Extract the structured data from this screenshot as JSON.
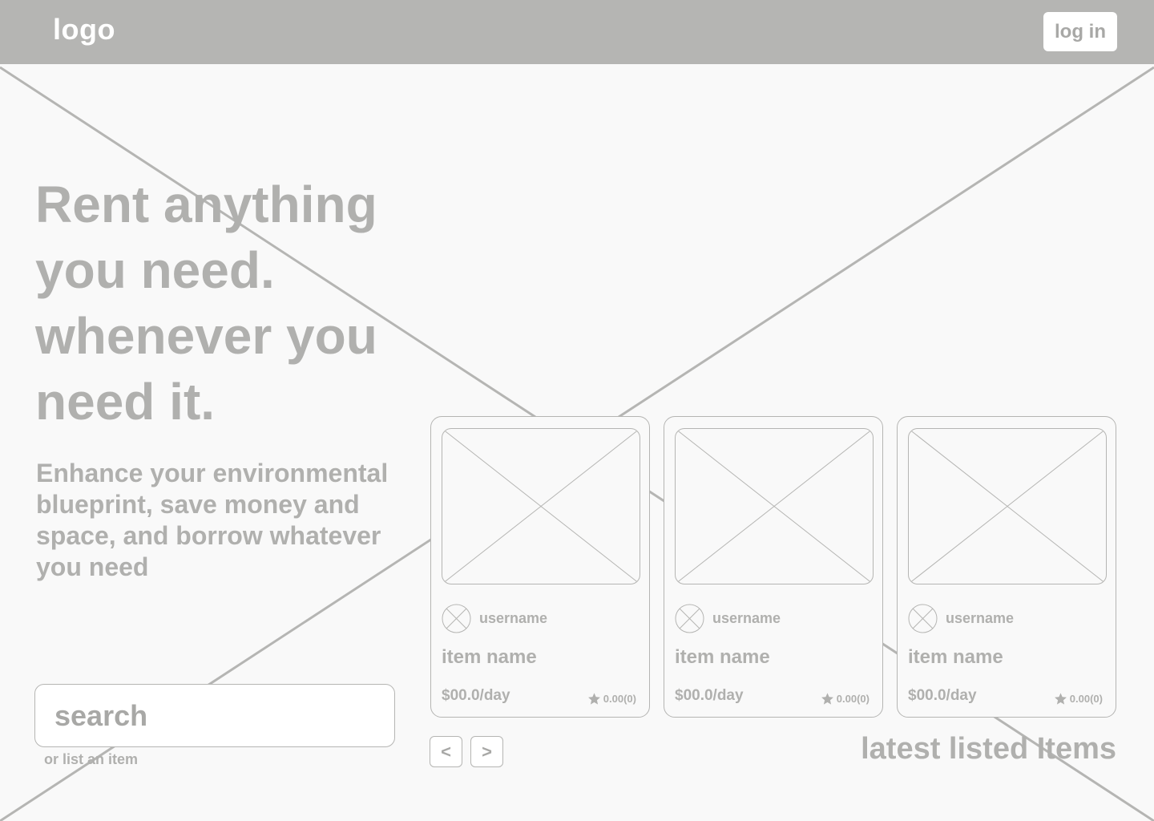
{
  "header": {
    "logo": "logo",
    "login_label": "log in"
  },
  "hero": {
    "title_lines": [
      "Rent anything",
      "you need.",
      "whenever you",
      "need it."
    ],
    "subtitle": "Enhance your environmental blueprint, save money and space, and borrow whatever you need"
  },
  "search": {
    "placeholder": "search",
    "list_item_link": "or list an item"
  },
  "listings": {
    "title": "latest listed Items",
    "prev_label": "<",
    "next_label": ">",
    "cards": [
      {
        "username": "username",
        "item_name": "item name",
        "price": "$00.0/day",
        "rating": "0.00(0)"
      },
      {
        "username": "username",
        "item_name": "item name",
        "price": "$00.0/day",
        "rating": "0.00(0)"
      },
      {
        "username": "username",
        "item_name": "item name",
        "price": "$00.0/day",
        "rating": "0.00(0)"
      }
    ]
  },
  "colors": {
    "header_bg": "#b5b5b3",
    "text_gray": "#b0b0ae",
    "page_bg": "#f9f9f9",
    "border": "#b5b5b3"
  }
}
